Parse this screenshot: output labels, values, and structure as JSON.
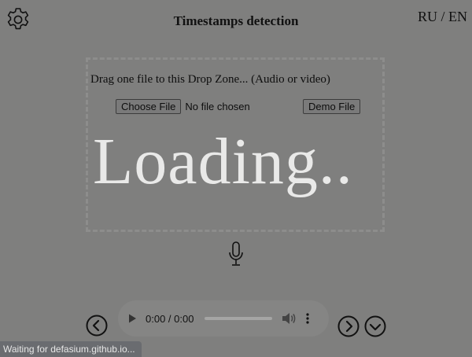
{
  "header": {
    "title": "Timestamps detection",
    "settings_icon": "gear-icon",
    "lang_ru": "RU",
    "lang_sep": " / ",
    "lang_en": "EN"
  },
  "dropzone": {
    "instruction": "Drag one file to this Drop Zone... (Audio or video)",
    "choose_file_label": "Choose File",
    "no_file_text": "No file chosen",
    "demo_file_label": "Demo File",
    "loading_text": "Loading.."
  },
  "mic": {
    "icon": "microphone-icon"
  },
  "player": {
    "time": "0:00 / 0:00",
    "play_icon": "play-icon",
    "volume_icon": "volume-icon",
    "more_icon": "more-vertical-icon",
    "progress": 0
  },
  "nav": {
    "prev_icon": "chevron-left-icon",
    "next_icon": "chevron-right-icon",
    "down_icon": "chevron-down-icon"
  },
  "status_bar": {
    "text": "Waiting for defasium.github.io..."
  }
}
